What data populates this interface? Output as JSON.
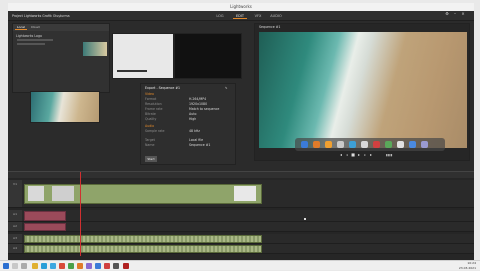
{
  "window": {
    "title": "Lightworks"
  },
  "topbar": {
    "project_label": "Project Lightworks Grafik Oluşturma",
    "tabs": [
      "LOG",
      "EDIT",
      "VFX",
      "AUDIO"
    ],
    "active_tab": "EDIT"
  },
  "browser": {
    "title": "Lightworks Logo",
    "tabs": [
      "Local",
      "Cloud"
    ]
  },
  "viewer": {
    "label": "Sequence #1"
  },
  "export": {
    "title": "Export - Sequence #1",
    "section_video": "Video",
    "section_audio": "Audio",
    "rows": [
      {
        "label": "Format",
        "value": "H.264/MP4"
      },
      {
        "label": "Resolution",
        "value": "1920x1080"
      },
      {
        "label": "Frame rate",
        "value": "Match to sequence"
      },
      {
        "label": "Bitrate",
        "value": "Auto"
      },
      {
        "label": "Quality",
        "value": "High"
      },
      {
        "label": "Sample rate",
        "value": "48 kHz"
      },
      {
        "label": "Target",
        "value": "Local file"
      },
      {
        "label": "Name",
        "value": "Sequence #1"
      }
    ],
    "start_button": "Start"
  },
  "timeline": {
    "tracks": [
      "V1",
      "A1",
      "A2",
      "A3",
      "A4"
    ]
  },
  "taskbar": {
    "time": "10:24",
    "date": "23.03.2021"
  },
  "colors": {
    "accent": "#e38a2b",
    "clip_video": "#8fa46a",
    "clip_audio": "#9a4a5a",
    "playhead": "#d03030"
  }
}
